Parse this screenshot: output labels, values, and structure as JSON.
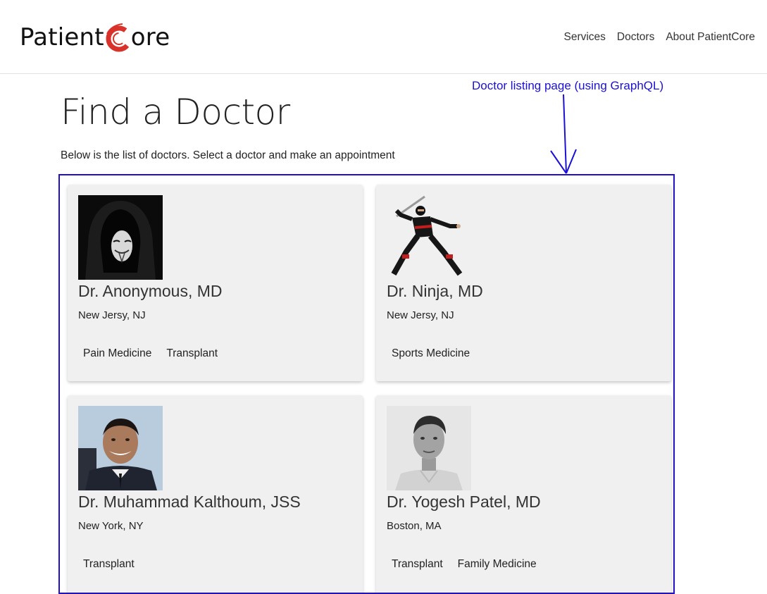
{
  "header": {
    "logo_text_left": "Patient",
    "logo_text_right": "ore",
    "nav": [
      "Services",
      "Doctors",
      "About PatientCore"
    ]
  },
  "page": {
    "title": "Find a Doctor",
    "intro": "Below is the list of doctors. Select a doctor and make an appointment"
  },
  "annotation": {
    "text": "Doctor listing page (using GraphQL)",
    "color": "#1a10d6"
  },
  "doctors": [
    {
      "name": "Dr. Anonymous, MD",
      "location": "New Jersy, NJ",
      "specialties": [
        "Pain Medicine",
        "Transplant"
      ],
      "photo": "hooded-mask-photo"
    },
    {
      "name": "Dr. Ninja, MD",
      "location": "New Jersy, NJ",
      "specialties": [
        "Sports Medicine"
      ],
      "photo": "ninja-figure-photo"
    },
    {
      "name": "Dr. Muhammad Kalthoum, JSS",
      "location": "New York, NY",
      "specialties": [
        "Transplant"
      ],
      "photo": "smiling-man-photo"
    },
    {
      "name": "Dr. Yogesh Patel, MD",
      "location": "Boston, MA",
      "specialties": [
        "Transplant",
        "Family Medicine"
      ],
      "photo": "man-portrait-photo"
    }
  ],
  "colors": {
    "brand_red": "#d9322a",
    "card_bg": "#f0f0f0"
  }
}
